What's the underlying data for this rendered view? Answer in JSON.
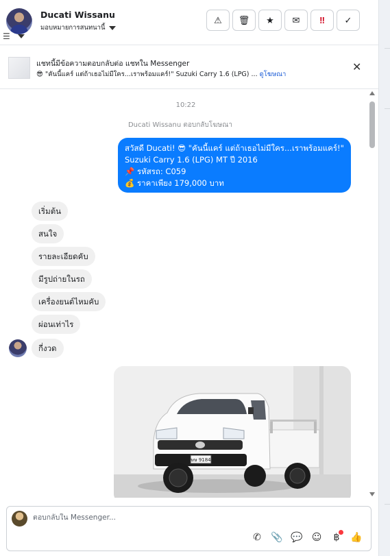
{
  "header": {
    "contact_name": "Ducati Wissanu",
    "assign_label": "มอบหมายการสนทนานี้",
    "actions": [
      {
        "icon": "warning-icon",
        "glyph": "⚠"
      },
      {
        "icon": "trash-icon",
        "glyph": "🗑"
      },
      {
        "icon": "star-icon",
        "glyph": "★"
      },
      {
        "icon": "open-envelope-icon",
        "glyph": "✉"
      },
      {
        "icon": "double-exclamation-icon",
        "glyph": "‼"
      },
      {
        "icon": "checkmark-icon",
        "glyph": "✓"
      }
    ]
  },
  "ad_banner": {
    "title": "แชทนี้มีข้อความตอบกลับต่อ แชทใน Messenger",
    "preview": "😎 \"คันนี้แคร์ แต่ถ้าเธอไม่มีใคร...เราพร้อมแคร์!\" Suzuki Carry 1.6 (LPG) ...",
    "link": "ดูโฆษณา"
  },
  "chat": {
    "time": "10:22",
    "replied_note": "Ducati Wissanu ตอบกลับโฆษณา",
    "outgoing": [
      "สวัสดี Ducati! 😎 \"คันนี้แคร์ แต่ถ้าเธอไม่มีใคร...เราพร้อมแคร์!\"",
      "Suzuki Carry 1.6 (LPG) MT ปี 2016",
      "📌 รหัสรถ: C059",
      "💰 ราคาเพียง 179,000 บาท"
    ],
    "incoming": [
      "เริ่มต้น",
      "สนใจ",
      "รายละเอียดคับ",
      "มีรูปถ่ายในรถ",
      "เครื่องยนต์ไหมคับ",
      "ผ่อนเท่าไร",
      "กี่งวด"
    ],
    "plate_text": "ษษ 9184"
  },
  "composer": {
    "placeholder": "ตอบกลับใน Messenger...",
    "tools": [
      {
        "icon": "phone-icon",
        "glyph": "✆"
      },
      {
        "icon": "paperclip-icon",
        "glyph": "📎"
      },
      {
        "icon": "chat-bubble-icon",
        "glyph": "💬"
      },
      {
        "icon": "emoji-icon",
        "glyph": "☺"
      },
      {
        "icon": "baht-icon",
        "glyph": "฿"
      },
      {
        "icon": "thumbs-up-icon",
        "glyph": "👍"
      }
    ]
  }
}
